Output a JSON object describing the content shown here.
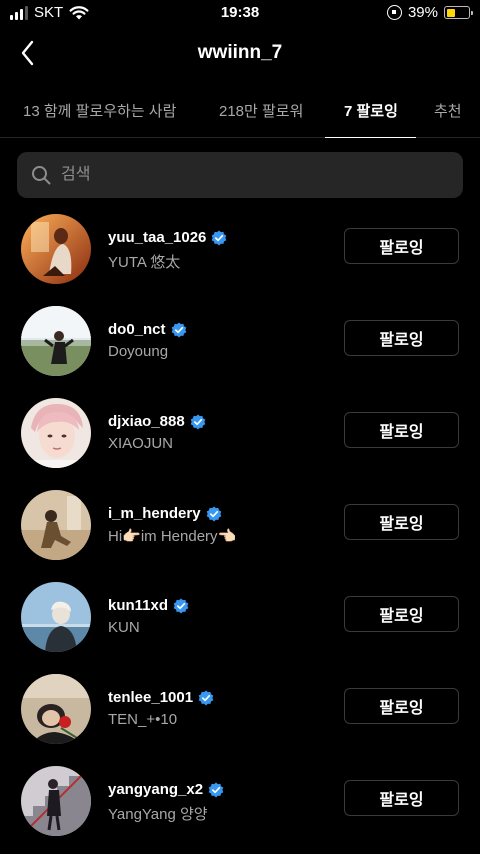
{
  "status_bar": {
    "carrier": "SKT",
    "time": "19:38",
    "battery": "39%",
    "battery_level": 0.39,
    "icons": [
      "signal-icon",
      "wifi-icon",
      "orientation-lock-icon",
      "battery-icon"
    ]
  },
  "header": {
    "title": "wwiinn_7",
    "back_icon": "chevron-left-icon"
  },
  "tabs": [
    {
      "label": "13 함께 팔로우하는 사람",
      "active": false
    },
    {
      "label": "218만 팔로워",
      "active": false
    },
    {
      "label": "7 팔로잉",
      "active": true
    },
    {
      "label": "추천",
      "active": false
    }
  ],
  "search": {
    "placeholder": "검색",
    "value": "",
    "icon": "search-icon"
  },
  "users": [
    {
      "username": "yuu_taa_1026",
      "name": "YUTA 悠太",
      "verified": true,
      "button": "팔로잉"
    },
    {
      "username": "do0_nct",
      "name": "Doyoung",
      "verified": true,
      "button": "팔로잉"
    },
    {
      "username": "djxiao_888",
      "name": "XIAOJUN",
      "verified": true,
      "button": "팔로잉"
    },
    {
      "username": "i_m_hendery",
      "name": "Hi👉🏻im Hendery👈🏻",
      "verified": true,
      "button": "팔로잉"
    },
    {
      "username": "kun11xd",
      "name": "KUN",
      "verified": true,
      "button": "팔로잉"
    },
    {
      "username": "tenlee_1001",
      "name": "TEN_+•10",
      "verified": true,
      "button": "팔로잉"
    },
    {
      "username": "yangyang_x2",
      "name": "YangYang 양양",
      "verified": true,
      "button": "팔로잉"
    }
  ],
  "colors": {
    "background": "#000000",
    "secondary_text": "#a8a8a8",
    "verified_badge": "#3897f0",
    "search_bg": "#262626",
    "battery": "#ffd60a"
  }
}
